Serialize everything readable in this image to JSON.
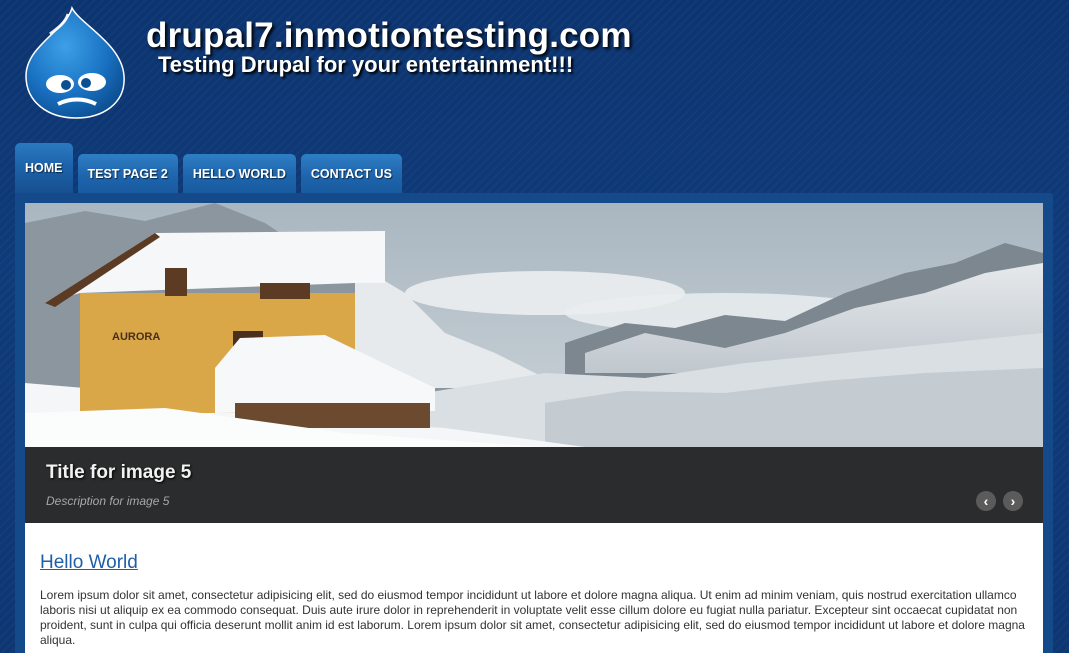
{
  "header": {
    "site_name": "drupal7.inmotiontesting.com",
    "slogan": "Testing Drupal for your entertainment!!!",
    "logo_icon": "drupal-drop-logo-icon"
  },
  "nav": {
    "items": [
      {
        "label": "HOME",
        "active": true
      },
      {
        "label": "TEST PAGE 2",
        "active": false
      },
      {
        "label": "HELLO WORLD",
        "active": false
      },
      {
        "label": "CONTACT US",
        "active": false
      }
    ]
  },
  "slideshow": {
    "caption_title": "Title for image 5",
    "caption_description": "Description for image 5",
    "house_sign": "AURORA",
    "prev_icon": "chevron-left-icon",
    "next_icon": "chevron-right-icon",
    "prev_glyph": "‹",
    "next_glyph": "›"
  },
  "content": {
    "title": "Hello World",
    "body": "Lorem ipsum dolor sit amet, consectetur adipisicing elit, sed do eiusmod tempor incididunt ut labore et dolore magna aliqua. Ut enim ad minim veniam, quis nostrud exercitation ullamco laboris nisi ut aliquip ex ea commodo consequat. Duis aute irure dolor in reprehenderit in voluptate velit esse cillum dolore eu fugiat nulla pariatur. Excepteur sint occaecat cupidatat non proident, sunt in culpa qui officia deserunt mollit anim id est laborum. Lorem ipsum dolor sit amet, consectetur adipisicing elit, sed do eiusmod tempor incididunt ut labore et dolore magna aliqua."
  },
  "colors": {
    "background": "#0f3a78",
    "tab": "#1e65ac",
    "link": "#1f5fa8"
  }
}
